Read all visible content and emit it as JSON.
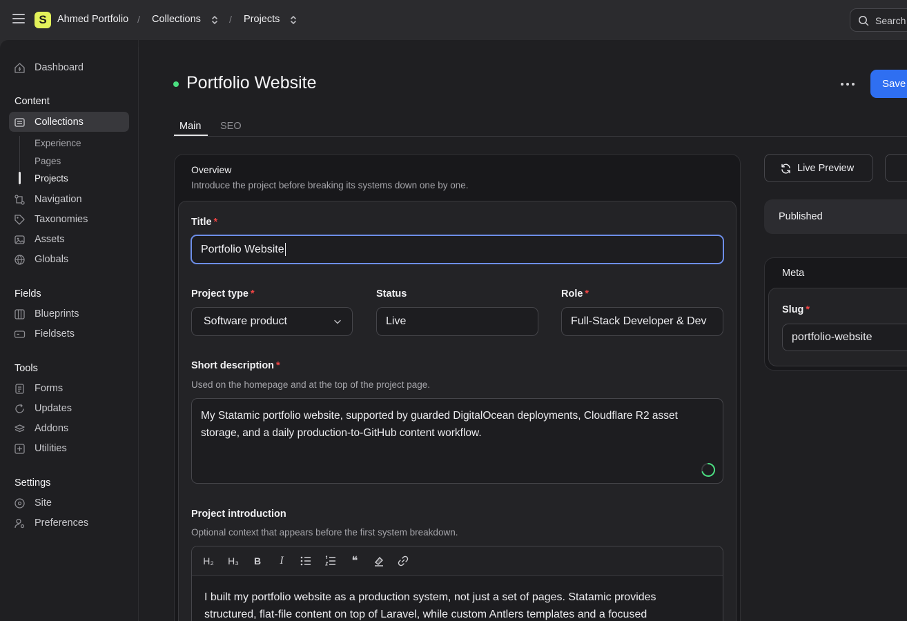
{
  "header": {
    "site_name": "Ahmed Portfolio",
    "logo_letter": "S",
    "breadcrumb_sep": "/",
    "crumb_collections": "Collections",
    "crumb_projects": "Projects",
    "search_label": "Search"
  },
  "sidebar": {
    "dashboard": "Dashboard",
    "content_heading": "Content",
    "collections": "Collections",
    "sub_experience": "Experience",
    "sub_pages": "Pages",
    "sub_projects": "Projects",
    "navigation": "Navigation",
    "taxonomies": "Taxonomies",
    "assets": "Assets",
    "globals": "Globals",
    "fields_heading": "Fields",
    "blueprints": "Blueprints",
    "fieldsets": "Fieldsets",
    "tools_heading": "Tools",
    "forms": "Forms",
    "updates": "Updates",
    "addons": "Addons",
    "utilities": "Utilities",
    "settings_heading": "Settings",
    "site": "Site",
    "preferences": "Preferences"
  },
  "page": {
    "title": "Portfolio Website",
    "save_label": "Save",
    "tab_main": "Main",
    "tab_seo": "SEO",
    "status_color": "#4ade80",
    "accent_color": "#2f6ff1"
  },
  "overview": {
    "title": "Overview",
    "description": "Introduce the project before breaking its systems down one by one."
  },
  "form": {
    "title_label": "Title",
    "title_value": "Portfolio Website",
    "project_type_label": "Project type",
    "project_type_value": "Software product",
    "status_label": "Status",
    "status_value": "Live",
    "role_label": "Role",
    "role_value": "Full-Stack Developer & Dev",
    "short_desc_label": "Short description",
    "short_desc_help": "Used on the homepage and at the top of the project page.",
    "short_desc_value": "My Statamic portfolio website, supported by guarded DigitalOcean deployments, Cloudflare R2 asset storage, and a daily production-to-GitHub content workflow.",
    "intro_label": "Project introduction",
    "intro_help": "Optional context that appears before the first system breakdown.",
    "intro_value": "I built my portfolio website as a production system, not just a set of pages. Statamic provides structured, flat-file content on top of Laravel, while custom Antlers templates and a focused",
    "required_mark": "*"
  },
  "toolbar": {
    "h2": "H₂",
    "h3": "H₃",
    "bold": "B",
    "italic": "I",
    "quote": "❝",
    "icons": [
      "h2-icon",
      "h3-icon",
      "bold-icon",
      "italic-icon",
      "bullet-list-icon",
      "numbered-list-icon",
      "quote-icon",
      "eraser-icon",
      "link-icon"
    ]
  },
  "right": {
    "live_preview": "Live Preview",
    "published": "Published",
    "meta_title": "Meta",
    "slug_label": "Slug",
    "slug_value": "portfolio-website"
  }
}
